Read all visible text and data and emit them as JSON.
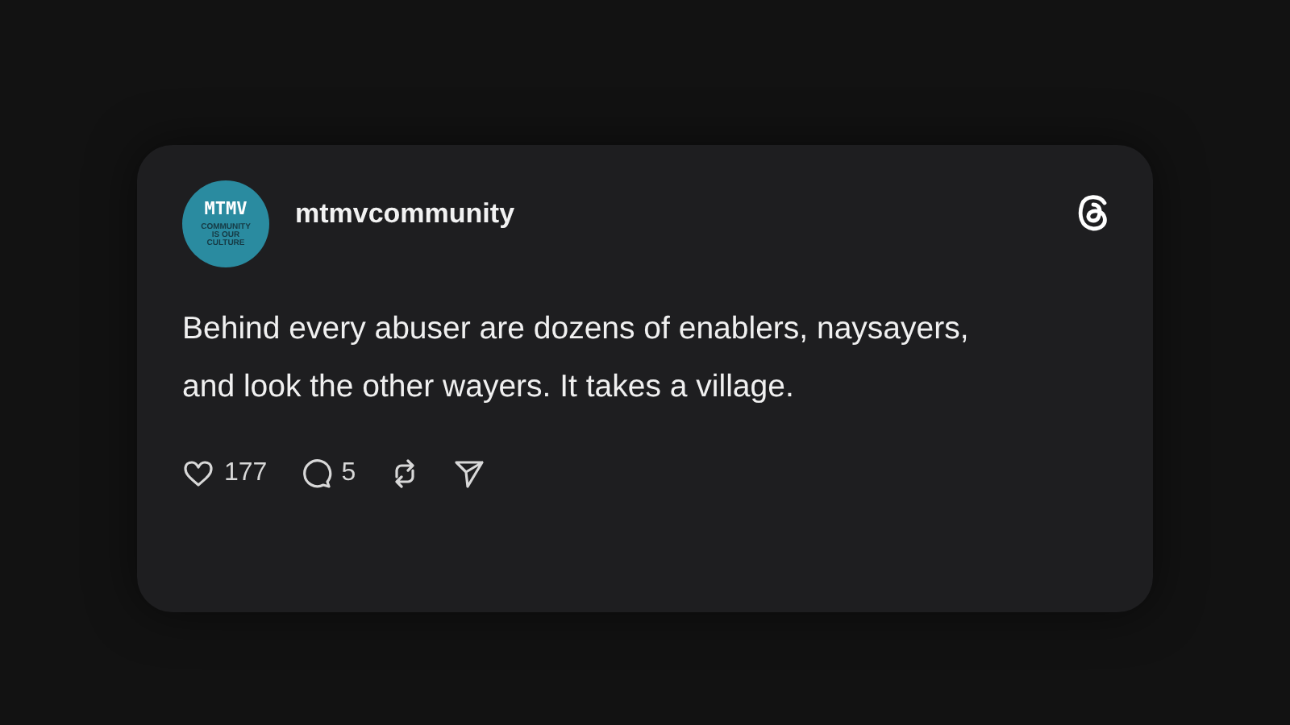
{
  "post": {
    "avatar": {
      "title": "MTMV",
      "tagline": [
        "COMMUNITY",
        "IS OUR",
        "CULTURE"
      ]
    },
    "username": "mtmvcommunity",
    "text": "Behind every abuser are dozens of enablers, naysayers, and look the other wayers. It takes a village.",
    "actions": [
      {
        "kind": "like",
        "count": "177"
      },
      {
        "kind": "reply",
        "count": "5"
      },
      {
        "kind": "repost"
      },
      {
        "kind": "share"
      }
    ]
  }
}
